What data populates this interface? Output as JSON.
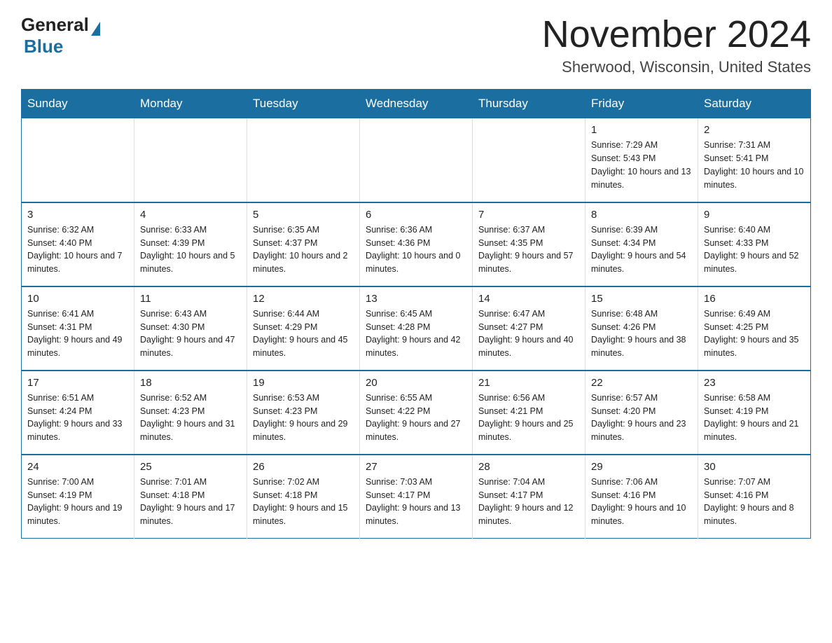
{
  "header": {
    "logo_general": "General",
    "logo_blue": "Blue",
    "title": "November 2024",
    "subtitle": "Sherwood, Wisconsin, United States"
  },
  "days_of_week": [
    "Sunday",
    "Monday",
    "Tuesday",
    "Wednesday",
    "Thursday",
    "Friday",
    "Saturday"
  ],
  "weeks": [
    [
      {
        "day": "",
        "info": ""
      },
      {
        "day": "",
        "info": ""
      },
      {
        "day": "",
        "info": ""
      },
      {
        "day": "",
        "info": ""
      },
      {
        "day": "",
        "info": ""
      },
      {
        "day": "1",
        "info": "Sunrise: 7:29 AM\nSunset: 5:43 PM\nDaylight: 10 hours and 13 minutes."
      },
      {
        "day": "2",
        "info": "Sunrise: 7:31 AM\nSunset: 5:41 PM\nDaylight: 10 hours and 10 minutes."
      }
    ],
    [
      {
        "day": "3",
        "info": "Sunrise: 6:32 AM\nSunset: 4:40 PM\nDaylight: 10 hours and 7 minutes."
      },
      {
        "day": "4",
        "info": "Sunrise: 6:33 AM\nSunset: 4:39 PM\nDaylight: 10 hours and 5 minutes."
      },
      {
        "day": "5",
        "info": "Sunrise: 6:35 AM\nSunset: 4:37 PM\nDaylight: 10 hours and 2 minutes."
      },
      {
        "day": "6",
        "info": "Sunrise: 6:36 AM\nSunset: 4:36 PM\nDaylight: 10 hours and 0 minutes."
      },
      {
        "day": "7",
        "info": "Sunrise: 6:37 AM\nSunset: 4:35 PM\nDaylight: 9 hours and 57 minutes."
      },
      {
        "day": "8",
        "info": "Sunrise: 6:39 AM\nSunset: 4:34 PM\nDaylight: 9 hours and 54 minutes."
      },
      {
        "day": "9",
        "info": "Sunrise: 6:40 AM\nSunset: 4:33 PM\nDaylight: 9 hours and 52 minutes."
      }
    ],
    [
      {
        "day": "10",
        "info": "Sunrise: 6:41 AM\nSunset: 4:31 PM\nDaylight: 9 hours and 49 minutes."
      },
      {
        "day": "11",
        "info": "Sunrise: 6:43 AM\nSunset: 4:30 PM\nDaylight: 9 hours and 47 minutes."
      },
      {
        "day": "12",
        "info": "Sunrise: 6:44 AM\nSunset: 4:29 PM\nDaylight: 9 hours and 45 minutes."
      },
      {
        "day": "13",
        "info": "Sunrise: 6:45 AM\nSunset: 4:28 PM\nDaylight: 9 hours and 42 minutes."
      },
      {
        "day": "14",
        "info": "Sunrise: 6:47 AM\nSunset: 4:27 PM\nDaylight: 9 hours and 40 minutes."
      },
      {
        "day": "15",
        "info": "Sunrise: 6:48 AM\nSunset: 4:26 PM\nDaylight: 9 hours and 38 minutes."
      },
      {
        "day": "16",
        "info": "Sunrise: 6:49 AM\nSunset: 4:25 PM\nDaylight: 9 hours and 35 minutes."
      }
    ],
    [
      {
        "day": "17",
        "info": "Sunrise: 6:51 AM\nSunset: 4:24 PM\nDaylight: 9 hours and 33 minutes."
      },
      {
        "day": "18",
        "info": "Sunrise: 6:52 AM\nSunset: 4:23 PM\nDaylight: 9 hours and 31 minutes."
      },
      {
        "day": "19",
        "info": "Sunrise: 6:53 AM\nSunset: 4:23 PM\nDaylight: 9 hours and 29 minutes."
      },
      {
        "day": "20",
        "info": "Sunrise: 6:55 AM\nSunset: 4:22 PM\nDaylight: 9 hours and 27 minutes."
      },
      {
        "day": "21",
        "info": "Sunrise: 6:56 AM\nSunset: 4:21 PM\nDaylight: 9 hours and 25 minutes."
      },
      {
        "day": "22",
        "info": "Sunrise: 6:57 AM\nSunset: 4:20 PM\nDaylight: 9 hours and 23 minutes."
      },
      {
        "day": "23",
        "info": "Sunrise: 6:58 AM\nSunset: 4:19 PM\nDaylight: 9 hours and 21 minutes."
      }
    ],
    [
      {
        "day": "24",
        "info": "Sunrise: 7:00 AM\nSunset: 4:19 PM\nDaylight: 9 hours and 19 minutes."
      },
      {
        "day": "25",
        "info": "Sunrise: 7:01 AM\nSunset: 4:18 PM\nDaylight: 9 hours and 17 minutes."
      },
      {
        "day": "26",
        "info": "Sunrise: 7:02 AM\nSunset: 4:18 PM\nDaylight: 9 hours and 15 minutes."
      },
      {
        "day": "27",
        "info": "Sunrise: 7:03 AM\nSunset: 4:17 PM\nDaylight: 9 hours and 13 minutes."
      },
      {
        "day": "28",
        "info": "Sunrise: 7:04 AM\nSunset: 4:17 PM\nDaylight: 9 hours and 12 minutes."
      },
      {
        "day": "29",
        "info": "Sunrise: 7:06 AM\nSunset: 4:16 PM\nDaylight: 9 hours and 10 minutes."
      },
      {
        "day": "30",
        "info": "Sunrise: 7:07 AM\nSunset: 4:16 PM\nDaylight: 9 hours and 8 minutes."
      }
    ]
  ]
}
